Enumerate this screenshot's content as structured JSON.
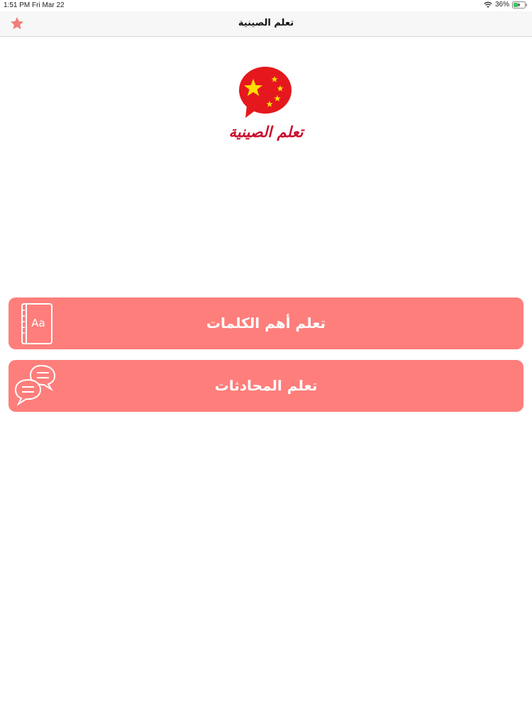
{
  "status_bar": {
    "time": "1:51 PM",
    "date": "Fri Mar 22",
    "battery": "36%",
    "wifi_icon": "wifi-icon",
    "battery_icon": "battery-charging-icon"
  },
  "nav": {
    "title": "تعلم الصينية",
    "favorite_icon": "star-icon"
  },
  "logo": {
    "text": "تعلم الصينية",
    "icon": "china-flag-speech-bubble-icon"
  },
  "menu": [
    {
      "label": "تعلم أهم الكلمات",
      "icon": "dictionary-book-icon"
    },
    {
      "label": "تعلم المحادثات",
      "icon": "chat-bubbles-icon"
    }
  ],
  "colors": {
    "accent": "#fe7e7b",
    "star": "#f17e7a",
    "logo_red": "#e5181d",
    "logo_yellow": "#ffde00",
    "logo_text": "#c8102e"
  }
}
